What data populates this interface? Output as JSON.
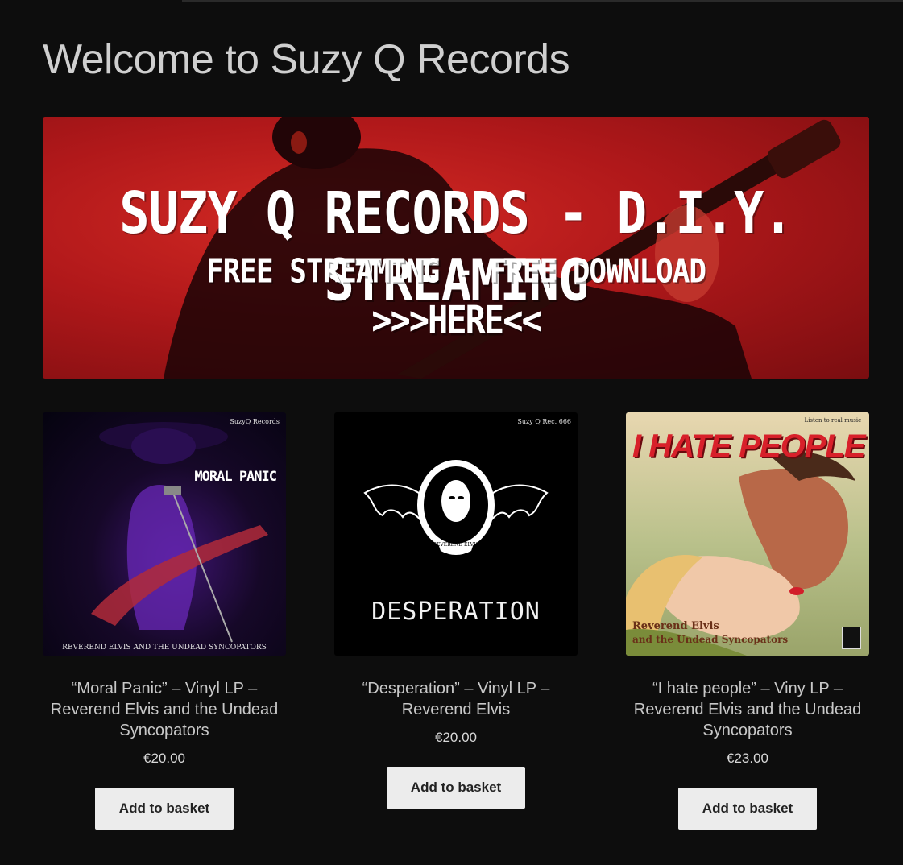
{
  "page": {
    "title": "Welcome to Suzy Q Records"
  },
  "banner": {
    "line1": "SUZY Q RECORDS - D.I.Y. STREAMING",
    "line2": "FREE STREAMING - FREE DOWNLOAD",
    "line3": ">>>HERE<<"
  },
  "products": [
    {
      "title": "“Moral Panic” – Vinyl LP – Reverend Elvis and the Undead Syncopators",
      "price": "€20.00",
      "button": "Add to basket",
      "cover": {
        "label_top": "SuzyQ Records",
        "headline": "MORAL PANIC",
        "label_bottom": "REVEREND ELVIS AND THE UNDEAD SYNCOPATORS",
        "colors": {
          "bg": "#05030f",
          "accent": "#8a2ed8"
        }
      }
    },
    {
      "title": "“Desperation” – Vinyl LP – Reverend Elvis",
      "price": "€20.00",
      "button": "Add to basket",
      "cover": {
        "label_top": "Suzy Q Rec. 666",
        "headline": "DESPERATION",
        "emblem_label": "REVEREND ELVIS",
        "colors": {
          "bg": "#000000",
          "accent": "#ffffff"
        }
      }
    },
    {
      "title": "“I hate people” – Viny LP – Reverend Elvis and the Undead Syncopators",
      "price": "€23.00",
      "button": "Add to basket",
      "cover": {
        "label_top": "Listen to real music",
        "headline": "I HATE PEOPLE",
        "label_bottom_1": "Reverend Elvis",
        "label_bottom_2": "and the Undead Syncopators",
        "colors": {
          "bg": "#d9d19a",
          "accent": "#d8202a"
        }
      }
    }
  ],
  "theme": {
    "background": "#0d0d0d",
    "text": "#c8c8c8",
    "button_bg": "#ececec",
    "banner_red": "#c01f1f"
  }
}
